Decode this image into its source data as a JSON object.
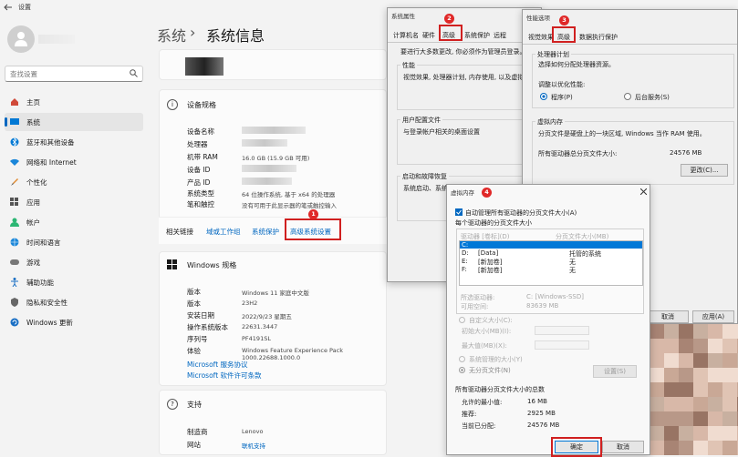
{
  "app": {
    "title": "设置",
    "breadcrumb_parent": "系统",
    "breadcrumb_sep": "›",
    "breadcrumb_current": "系统信息"
  },
  "search": {
    "placeholder": "查找设置"
  },
  "nav": [
    {
      "label": "主页",
      "icon": "home-icon"
    },
    {
      "label": "系统",
      "icon": "system-icon",
      "active": true
    },
    {
      "label": "蓝牙和其他设备",
      "icon": "bluetooth-icon"
    },
    {
      "label": "网络和 Internet",
      "icon": "wifi-icon"
    },
    {
      "label": "个性化",
      "icon": "brush-icon"
    },
    {
      "label": "应用",
      "icon": "apps-icon"
    },
    {
      "label": "帐户",
      "icon": "account-icon"
    },
    {
      "label": "时间和语言",
      "icon": "globe-icon"
    },
    {
      "label": "游戏",
      "icon": "gamepad-icon"
    },
    {
      "label": "辅助功能",
      "icon": "accessibility-icon"
    },
    {
      "label": "隐私和安全性",
      "icon": "shield-icon"
    },
    {
      "label": "Windows 更新",
      "icon": "update-icon"
    }
  ],
  "device_specs": {
    "title": "设备规格",
    "rows": [
      {
        "key": "设备名称",
        "value": ""
      },
      {
        "key": "处理器",
        "value": ""
      },
      {
        "key": "机带 RAM",
        "value": "16.0 GB (15.9 GB 可用)"
      },
      {
        "key": "设备 ID",
        "value": ""
      },
      {
        "key": "产品 ID",
        "value": ""
      },
      {
        "key": "系统类型",
        "value": "64 位操作系统, 基于 x64 的处理器"
      },
      {
        "key": "笔和触控",
        "value": "没有可用于此显示器的笔或触控输入"
      }
    ]
  },
  "related": {
    "label": "相关链接",
    "links": [
      "域或工作组",
      "系统保护",
      "高级系统设置"
    ],
    "badge": "1"
  },
  "windows_specs": {
    "title": "Windows 规格",
    "rows": [
      {
        "key": "版本",
        "value": "Windows 11 家庭中文版"
      },
      {
        "key": "版本",
        "value": "23H2"
      },
      {
        "key": "安装日期",
        "value": "2022/9/23 星期五"
      },
      {
        "key": "操作系统版本",
        "value": "22631.3447"
      },
      {
        "key": "序列号",
        "value": "PF4191SL"
      },
      {
        "key": "体验",
        "value": "Windows Feature Experience Pack 1000.22688.1000.0"
      }
    ],
    "links": [
      "Microsoft 服务协议",
      "Microsoft 软件许可条款"
    ]
  },
  "support": {
    "title": "支持",
    "rows": [
      {
        "key": "制造商",
        "value": "Lenovo"
      },
      {
        "key": "网站",
        "value": "联机支持"
      }
    ]
  },
  "sysprops": {
    "title": "系统属性",
    "tabs": [
      "计算机名",
      "硬件",
      "高级",
      "系统保护",
      "远程"
    ],
    "badge": "2",
    "admin_note": "要进行大多数更改, 你必须作为管理员登录。",
    "perf_label": "性能",
    "perf_desc": "视觉效果, 处理器计划, 内存使用, 以及虚拟内",
    "profile_label": "用户配置文件",
    "profile_desc": "与登录帐户相关的桌面设置",
    "startup_label": "启动和故障恢复",
    "startup_desc": "系统启动、系统故障和调"
  },
  "perfopts": {
    "title": "性能选项",
    "tabs": [
      "视觉效果",
      "高级",
      "数据执行保护"
    ],
    "badge": "3",
    "sched_label": "处理器计划",
    "sched_desc": "选择如何分配处理器资源。",
    "adjust_label": "调整以优化性能:",
    "opt_programs": "程序(P)",
    "opt_services": "后台服务(S)",
    "vm_label": "虚拟内存",
    "vm_desc": "分页文件是硬盘上的一块区域, Windows 当作 RAM 使用。",
    "vm_total_label": "所有驱动器总分页文件大小:",
    "vm_total_value": "24576 MB",
    "change_btn": "更改(C)...",
    "cancel_btn": "取消",
    "apply_btn": "应用(A)"
  },
  "vmem": {
    "title": "虚拟内存",
    "badge": "4",
    "auto_manage": "自动管理所有驱动器的分页文件大小(A)",
    "per_drive_label": "每个驱动器的分页文件大小",
    "col_drive": "驱动器 [卷标](D)",
    "col_size": "分页文件大小(MB)",
    "drives": [
      {
        "drive": "C:",
        "label": "",
        "size": "",
        "selected": true
      },
      {
        "drive": "D:",
        "label": "[Data]",
        "size": "托管的系统"
      },
      {
        "drive": "E:",
        "label": "[新加卷]",
        "size": "无"
      },
      {
        "drive": "F:",
        "label": "[新加卷]",
        "size": "无"
      }
    ],
    "selected_drive_label": "所选驱动器:",
    "selected_drive_value": "C: [Windows-SSD]",
    "available_label": "可用空间:",
    "available_value": "83639 MB",
    "custom_size": "自定义大小(C):",
    "initial_size": "初始大小(MB)(I):",
    "max_size": "最大值(MB)(X):",
    "system_managed": "系统管理的大小(Y)",
    "no_paging": "无分页文件(N)",
    "set_btn": "设置(S)",
    "total_label": "所有驱动器分页文件大小的总数",
    "min_label": "允许的最小值:",
    "min_value": "16 MB",
    "rec_label": "推荐:",
    "rec_value": "2925 MB",
    "cur_label": "当前已分配:",
    "cur_value": "24576 MB",
    "ok_btn": "确定",
    "cancel_btn": "取消"
  },
  "colors": {
    "accent": "#0067c0",
    "highlight": "#d02020"
  }
}
